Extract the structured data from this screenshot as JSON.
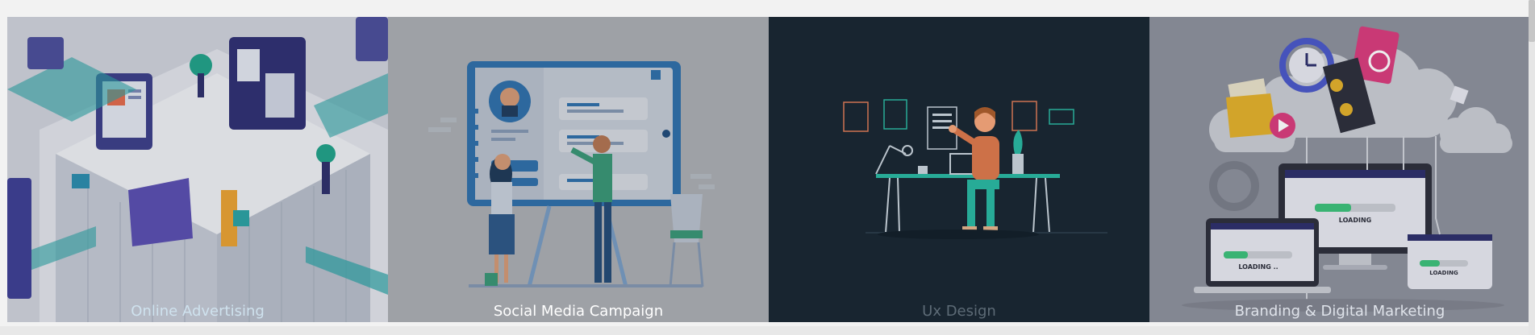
{
  "services": [
    {
      "label": "Online Advertising",
      "icon": "isometric-city-illustration",
      "caption_color": "#cfe2ee",
      "bg": "#d2d6de"
    },
    {
      "label": "Social Media Campaign",
      "icon": "presentation-board-illustration",
      "caption_color": "#ffffff",
      "bg": "#b9bbbf"
    },
    {
      "label": "Ux Design",
      "icon": "designer-desk-illustration",
      "caption_color": "#5d6b76",
      "bg": "#1a2733"
    },
    {
      "label": "Branding & Digital Marketing",
      "icon": "cloud-devices-illustration",
      "caption_color": "#dfe3ea",
      "bg": "#8d919c"
    }
  ],
  "devices": {
    "laptop_loading": "LOADING ..",
    "monitor_loading": "LOADING",
    "phone_loading": "LOADING"
  }
}
